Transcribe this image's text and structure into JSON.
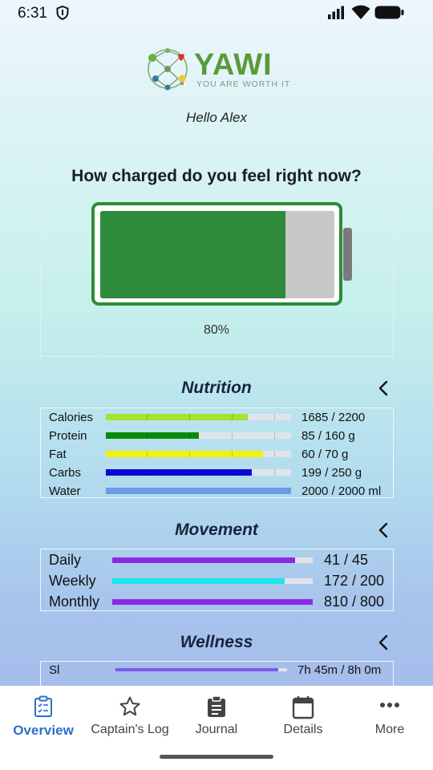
{
  "status_bar": {
    "time": "6:31"
  },
  "logo": {
    "wordmark": "YAWI",
    "tagline": "YOU ARE WORTH IT"
  },
  "greeting": "Hello Alex",
  "battery": {
    "question": "How charged do you feel right now?",
    "percent_label": "80%",
    "level": 0.79
  },
  "nutrition": {
    "title": "Nutrition",
    "rows": [
      {
        "label": "Calories",
        "value": "1685 / 2200",
        "fraction": 0.765,
        "color": "#a6e22e"
      },
      {
        "label": "Protein",
        "value": "85 / 160 g",
        "fraction": 0.5,
        "color": "#0a8a0a"
      },
      {
        "label": "Fat",
        "value": "60 / 70 g",
        "fraction": 0.85,
        "color": "#f2f20e"
      },
      {
        "label": "Carbs",
        "value": "199 / 250 g",
        "fraction": 0.79,
        "color": "#0a0ad4"
      },
      {
        "label": "Water",
        "value": "2000 / 2000 ml",
        "fraction": 1.0,
        "color": "#6a9ae8"
      }
    ]
  },
  "movement": {
    "title": "Movement",
    "rows": [
      {
        "label": "Daily",
        "value": "41 / 45",
        "fraction": 0.91,
        "color": "#8a2be2"
      },
      {
        "label": "Weekly",
        "value": "172 / 200",
        "fraction": 0.86,
        "color": "#1ee6ee"
      },
      {
        "label": "Monthly",
        "value": "810 / 800",
        "fraction": 1.0,
        "color": "#8a2be2"
      }
    ]
  },
  "wellness": {
    "title": "Wellness",
    "rows": [
      {
        "label": "Sl",
        "value": "7h 45m / 8h 0m",
        "fraction": 0.95,
        "color": "#7c5ce6"
      }
    ]
  },
  "nav": {
    "items": [
      {
        "label": "Overview",
        "icon": "clipboard-list-icon",
        "active": true
      },
      {
        "label": "Captain's Log",
        "icon": "star-icon",
        "active": false
      },
      {
        "label": "Journal",
        "icon": "journal-icon",
        "active": false
      },
      {
        "label": "Details",
        "icon": "calendar-icon",
        "active": false
      },
      {
        "label": "More",
        "icon": "more-dots-icon",
        "active": false
      }
    ]
  }
}
